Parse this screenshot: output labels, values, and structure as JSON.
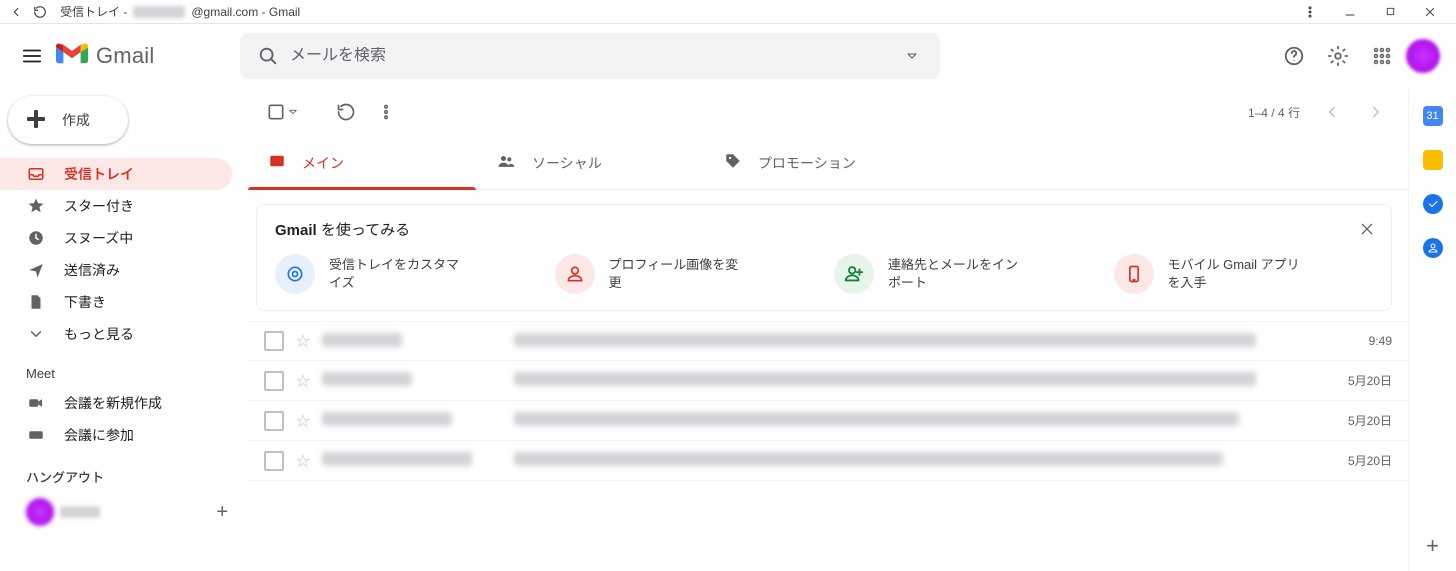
{
  "window": {
    "title_prefix": "受信トレイ -",
    "title_suffix": "@gmail.com - Gmail"
  },
  "header": {
    "product": "Gmail",
    "search_placeholder": "メールを検索"
  },
  "compose_label": "作成",
  "nav": {
    "inbox": "受信トレイ",
    "starred": "スター付き",
    "snoozed": "スヌーズ中",
    "sent": "送信済み",
    "drafts": "下書き",
    "more": "もっと見る"
  },
  "meet_header": "Meet",
  "meet": {
    "new": "会議を新規作成",
    "join": "会議に参加"
  },
  "hangouts_header": "ハングアウト",
  "toolbar": {
    "pager": "1–4 / 4 行"
  },
  "tabs": {
    "primary": "メイン",
    "social": "ソーシャル",
    "promotions": "プロモーション"
  },
  "try": {
    "title_bold": "Gmail",
    "title_rest": " を使ってみる",
    "tips": [
      "受信トレイをカスタマイズ",
      "プロフィール画像を変更",
      "連絡先とメールをインポート",
      "モバイル Gmail アプリを入手"
    ]
  },
  "rows": [
    {
      "date": "9:49"
    },
    {
      "date": "5月20日"
    },
    {
      "date": "5月20日"
    },
    {
      "date": "5月20日"
    }
  ],
  "colors": {
    "accent": "#d93025",
    "tip_gear_bg": "#e8f0fe",
    "tip_gear_fg": "#1a73e8",
    "tip_person_bg": "#fce8e6",
    "tip_person_fg": "#d93025",
    "tip_import_bg": "#e6f4ea",
    "tip_import_fg": "#188038",
    "tip_mobile_bg": "#fce8e6",
    "tip_mobile_fg": "#d93025"
  }
}
